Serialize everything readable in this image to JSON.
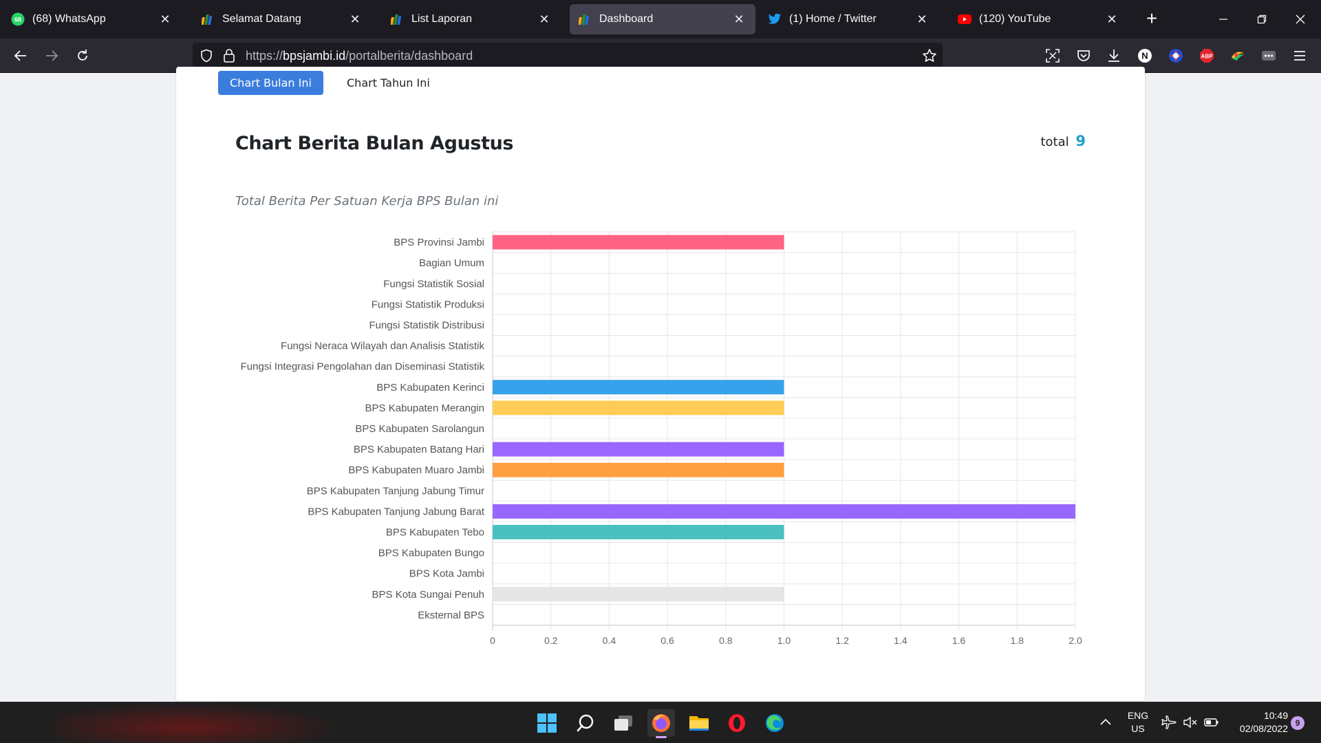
{
  "browser": {
    "tabs": [
      {
        "title": "(68) WhatsApp",
        "icon": "whatsapp-icon",
        "badge": "68",
        "active": false
      },
      {
        "title": "Selamat Datang",
        "icon": "bps-icon",
        "active": false
      },
      {
        "title": "List Laporan",
        "icon": "bps-icon",
        "active": false
      },
      {
        "title": "Dashboard",
        "icon": "bps-icon",
        "active": true
      },
      {
        "title": "(1) Home / Twitter",
        "icon": "twitter-icon",
        "active": false
      },
      {
        "title": "(120) YouTube",
        "icon": "youtube-icon",
        "active": false
      }
    ],
    "url_scheme": "https://",
    "url_domain": "bpsjambi.id",
    "url_path": "/portalberita/dashboard",
    "extensions": [
      "screenshot-icon",
      "pocket-icon",
      "download-icon",
      "n-extension-icon",
      "vpn-icon",
      "adblock-plus-icon",
      "colorful-extension-icon",
      "more-extension-icon",
      "menu-icon"
    ],
    "abp_label": "ABP",
    "n_label": "N"
  },
  "page": {
    "tabs": [
      "Chart Bulan Ini",
      "Chart Tahun Ini"
    ],
    "title": "Chart Berita Bulan Agustus",
    "total_label": "total",
    "total_value": "9",
    "subtitle": "Total Berita Per Satuan Kerja BPS Bulan ini"
  },
  "chart_data": {
    "type": "bar",
    "orientation": "horizontal",
    "categories": [
      "BPS Provinsi Jambi",
      "Bagian Umum",
      "Fungsi Statistik Sosial",
      "Fungsi Statistik Produksi",
      "Fungsi Statistik Distribusi",
      "Fungsi Neraca Wilayah dan Analisis Statistik",
      "Fungsi Integrasi Pengolahan dan Diseminasi Statistik",
      "BPS Kabupaten Kerinci",
      "BPS Kabupaten Merangin",
      "BPS Kabupaten Sarolangun",
      "BPS Kabupaten Batang Hari",
      "BPS Kabupaten Muaro Jambi",
      "BPS Kabupaten Tanjung Jabung Timur",
      "BPS Kabupaten Tanjung Jabung Barat",
      "BPS Kabupaten Tebo",
      "BPS Kabupaten Bungo",
      "BPS Kota Jambi",
      "BPS Kota Sungai Penuh",
      "Eksternal BPS"
    ],
    "values": [
      1,
      0,
      0,
      0,
      0,
      0,
      0,
      1,
      1,
      0,
      1,
      1,
      0,
      2,
      1,
      0,
      0,
      1,
      0
    ],
    "colors": [
      "#ff6384",
      "#ff9f40",
      "#ffcd56",
      "#4bc0c0",
      "#36a2eb",
      "#9966ff",
      "#c9cbcf",
      "#36a2eb",
      "#ffcd56",
      "#4bc0c0",
      "#9966ff",
      "#ff9f40",
      "#ff6384",
      "#9966ff",
      "#4bc0c0",
      "#36a2eb",
      "#ffcd56",
      "#e5e5e5",
      "#ff6384"
    ],
    "xlim": [
      0,
      2
    ],
    "x_ticks": [
      "0",
      "0.2",
      "0.4",
      "0.6",
      "0.8",
      "1.0",
      "1.2",
      "1.4",
      "1.6",
      "1.8",
      "2.0"
    ],
    "grid": true,
    "legend": "none"
  },
  "taskbar": {
    "apps": [
      "windows-start-icon",
      "search-icon",
      "task-view-icon",
      "firefox-icon",
      "file-explorer-icon",
      "opera-icon",
      "edge-icon"
    ],
    "lang_line1": "ENG",
    "lang_line2": "US",
    "time": "10:49",
    "date": "02/08/2022",
    "notification_count": "9"
  }
}
